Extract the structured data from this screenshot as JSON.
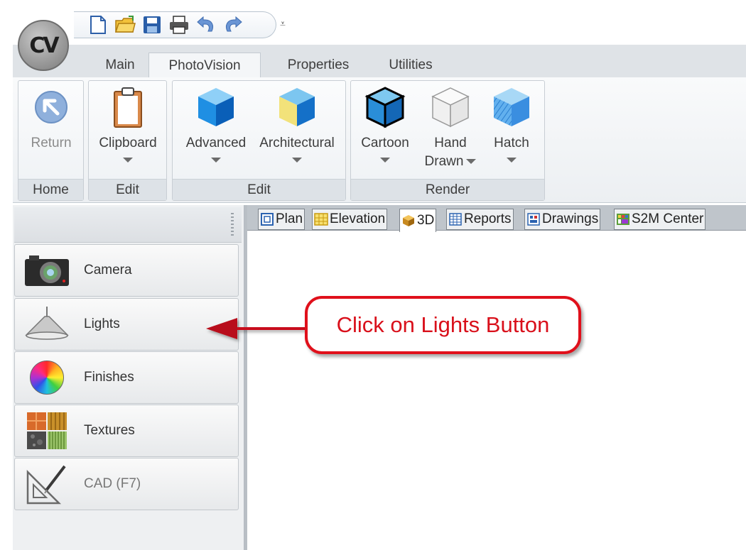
{
  "app": {
    "logo_text": "CV"
  },
  "quick_access": {
    "items": [
      "new-document-icon",
      "open-folder-icon",
      "save-icon",
      "print-icon",
      "undo-icon",
      "redo-icon"
    ],
    "more_glyph": "⩡"
  },
  "tabs": [
    {
      "label": "Main",
      "active": false
    },
    {
      "label": "PhotoVision",
      "active": true
    },
    {
      "label": "Properties",
      "active": false
    },
    {
      "label": "Utilities",
      "active": false
    }
  ],
  "ribbon": {
    "groups": [
      {
        "label": "Home"
      },
      {
        "label": "Edit"
      },
      {
        "label": "Edit"
      },
      {
        "label": "Render"
      }
    ],
    "buttons": {
      "return": "Return",
      "clipboard": "Clipboard",
      "advanced": "Advanced",
      "architectural": "Architectural",
      "cartoon": "Cartoon",
      "hand": "Hand",
      "drawn": "Drawn",
      "hatch": "Hatch"
    }
  },
  "left_panel": {
    "buttons": [
      {
        "label": "Camera",
        "icon": "camera-icon",
        "enabled": true
      },
      {
        "label": "Lights",
        "icon": "lamp-icon",
        "enabled": true
      },
      {
        "label": "Finishes",
        "icon": "color-wheel-icon",
        "enabled": true
      },
      {
        "label": "Textures",
        "icon": "textures-icon",
        "enabled": true
      },
      {
        "label": "CAD (F7)",
        "icon": "cad-triangle-icon",
        "enabled": false
      }
    ]
  },
  "doc_tabs": [
    {
      "label": "Plan",
      "active": false
    },
    {
      "label": "Elevation",
      "active": false
    },
    {
      "label": "3D",
      "active": true
    },
    {
      "label": "Reports",
      "active": false
    },
    {
      "label": "Drawings",
      "active": false
    },
    {
      "label": "S2M Center",
      "active": false
    }
  ],
  "annotation": {
    "callout_text": "Click on Lights Button",
    "color": "#e0101b"
  }
}
